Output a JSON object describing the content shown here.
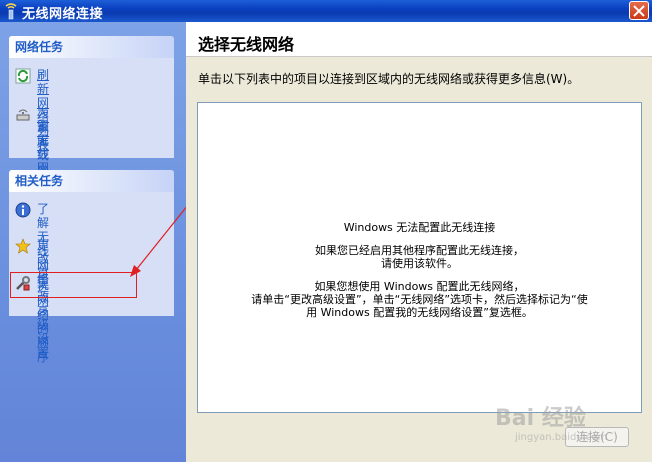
{
  "window": {
    "title": "无线网络连接"
  },
  "left": {
    "network_tasks": {
      "title": "网络任务",
      "items": [
        {
          "label": "刷新网络列表",
          "icon": "refresh-icon"
        },
        {
          "label": "为家庭或小型办公室设置无线网络",
          "line1": "为家庭或小型办公室设",
          "line2": "置无线网络",
          "icon": "wireless-setup-icon"
        }
      ]
    },
    "related_tasks": {
      "title": "相关任务",
      "items": [
        {
          "label": "了解无线网络",
          "icon": "info-icon"
        },
        {
          "label": "更改首选网络的顺序",
          "icon": "star-icon"
        },
        {
          "label": "更改高级设置",
          "icon": "tools-icon"
        }
      ]
    }
  },
  "main": {
    "title": "选择无线网络",
    "description": "单击以下列表中的项目以连接到区域内的无线网络或获得更多信息(W)。",
    "message": {
      "line1": "Windows 无法配置此无线连接",
      "line2": "如果您已经启用其他程序配置此无线连接，",
      "line3": "请使用该软件。",
      "line4": "如果您想使用 Windows 配置此无线网络，",
      "line5": "请单击“更改高级设置”，单击“无线网络”选项卡，然后选择标记为“使",
      "line6": "用 Windows 配置我的无线网络设置”复选框。"
    },
    "connect_button": "连接(C)"
  },
  "watermark": {
    "text": "Bai 经验",
    "sub": "jingyan.baidu.com"
  },
  "colors": {
    "titlebar": "#0b3bb0",
    "pane": "#6a8fde",
    "link": "#215dc6",
    "highlight": "#e02020"
  }
}
